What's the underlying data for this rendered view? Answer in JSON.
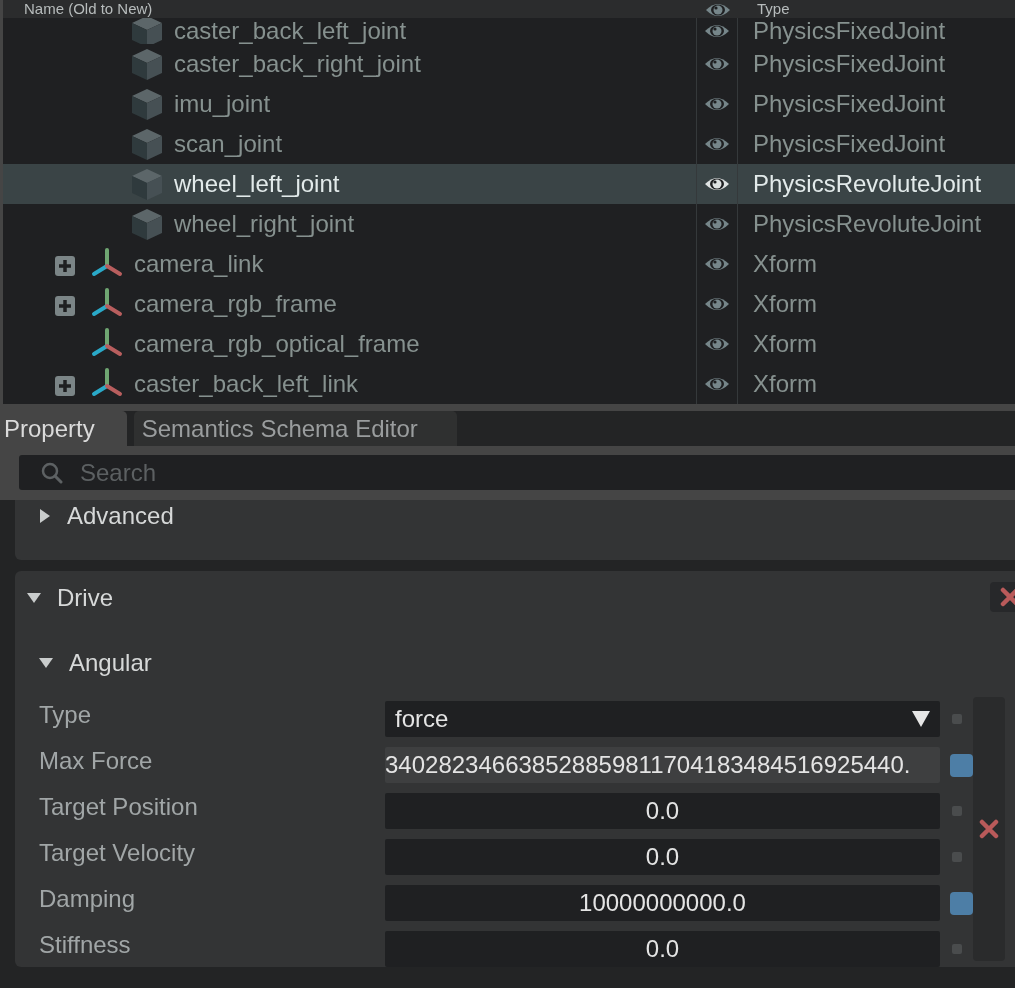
{
  "stage": {
    "columns": [
      {
        "label": "Name (Old to New)"
      },
      {
        "label": "Type"
      }
    ],
    "rows": [
      {
        "children": [
          {
            "name": "caster_back_left_joint",
            "type": "PhysicsFixedJoint",
            "kind": "joint",
            "visible": true,
            "selected": false,
            "expandable": false
          },
          {
            "name": "caster_back_right_joint",
            "type": "PhysicsFixedJoint",
            "kind": "joint",
            "visible": true,
            "selected": false,
            "expandable": false
          },
          {
            "name": "imu_joint",
            "type": "PhysicsFixedJoint",
            "kind": "joint",
            "visible": true,
            "selected": false,
            "expandable": false
          },
          {
            "name": "scan_joint",
            "type": "PhysicsFixedJoint",
            "kind": "joint",
            "visible": true,
            "selected": false,
            "expandable": false
          },
          {
            "name": "wheel_left_joint",
            "type": "PhysicsRevoluteJoint",
            "kind": "joint",
            "visible": true,
            "selected": true,
            "expandable": false
          },
          {
            "name": "wheel_right_joint",
            "type": "PhysicsRevoluteJoint",
            "kind": "joint",
            "visible": true,
            "selected": false,
            "expandable": false
          }
        ]
      },
      {
        "name": "camera_link",
        "type": "Xform",
        "kind": "xform",
        "visible": true,
        "selected": false,
        "expandable": true
      },
      {
        "name": "camera_rgb_frame",
        "type": "Xform",
        "kind": "xform",
        "visible": true,
        "selected": false,
        "expandable": true
      },
      {
        "name": "camera_rgb_optical_frame",
        "type": "Xform",
        "kind": "xform",
        "visible": true,
        "selected": false,
        "expandable": false
      },
      {
        "name": "caster_back_left_link",
        "type": "Xform",
        "kind": "xform",
        "visible": true,
        "selected": false,
        "expandable": true
      }
    ]
  },
  "tabs": [
    {
      "label": "Property",
      "selected": true
    },
    {
      "label": "Semantics Schema Editor",
      "selected": false
    }
  ],
  "search": {
    "placeholder": "Search"
  },
  "sections": [
    {
      "title": "Advanced",
      "expanded": false,
      "removable": false
    },
    {
      "title": "Drive",
      "expanded": true,
      "removable": true,
      "groups": [
        {
          "title": "Angular",
          "expanded": true,
          "removable": true,
          "properties": [
            {
              "kind": "dropdown",
              "label": "Type",
              "value": "force",
              "modified": false,
              "focused": false
            },
            {
              "kind": "number",
              "label": "Max Force",
              "value": "340282346638528859811704183484516925440.",
              "modified": true,
              "focused": true
            },
            {
              "kind": "number",
              "label": "Target Position",
              "value": "0.0",
              "modified": false,
              "focused": false
            },
            {
              "kind": "number",
              "label": "Target Velocity",
              "value": "0.0",
              "modified": false,
              "focused": false
            },
            {
              "kind": "number",
              "label": "Damping",
              "value": "10000000000.0",
              "modified": true,
              "focused": false
            },
            {
              "kind": "number",
              "label": "Stiffness",
              "value": "0.0",
              "modified": false,
              "focused": false
            }
          ]
        }
      ]
    }
  ]
}
